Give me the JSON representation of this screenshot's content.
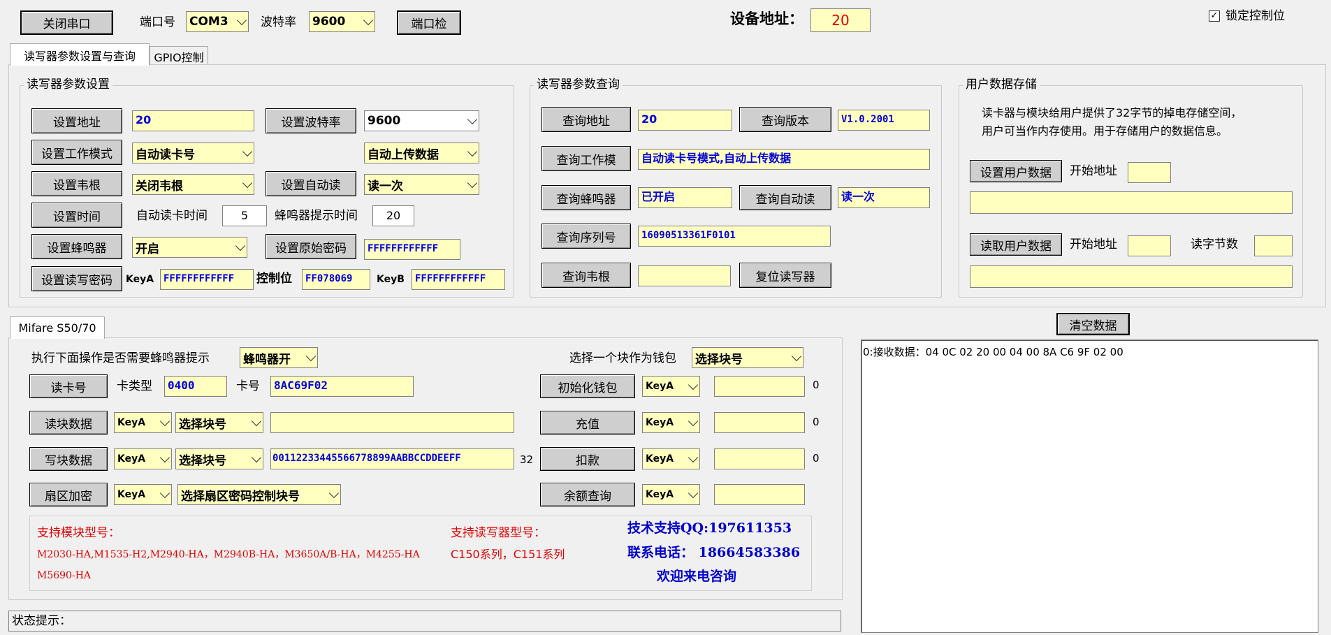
{
  "top": {
    "close_port": "关闭串口",
    "port_label": "端口号",
    "port_value": "COM3",
    "baud_label": "波特率",
    "baud_value": "9600",
    "port_check": "端口检",
    "device_addr_label": "设备地址：",
    "device_addr_value": "20",
    "lock_label": "锁定控制位",
    "lock_checked": true
  },
  "tabs": [
    "读写器参数设置与查询",
    "GPIO控制"
  ],
  "settings": {
    "title": "读写器参数设置",
    "set_addr": "设置地址",
    "addr_value": "20",
    "set_baud": "设置波特率",
    "baud_value": "9600",
    "set_mode": "设置工作模式",
    "mode_value": "自动读卡号",
    "upload_value": "自动上传数据",
    "set_wiegand": "设置韦根",
    "wiegand_value": "关闭韦根",
    "set_autoread": "设置自动读",
    "autoread_value": "读一次",
    "set_time": "设置时间",
    "autoread_time_label": "自动读卡时间",
    "autoread_time": "5",
    "buzzer_time_label": "蜂鸣器提示时间",
    "buzzer_time": "20",
    "set_buzzer": "设置蜂鸣器",
    "buzzer_value": "开启",
    "set_orig_pwd": "设置原始密码",
    "orig_pwd": "FFFFFFFFFFFF",
    "set_rw_pwd": "设置读写密码",
    "keya_label": "KeyA",
    "keya": "FFFFFFFFFFFF",
    "ctrl_label": "控制位",
    "ctrl": "FF078069",
    "keyb_label": "KeyB",
    "keyb": "FFFFFFFFFFFF"
  },
  "query": {
    "title": "读写器参数查询",
    "q_addr": "查询地址",
    "addr": "20",
    "q_version": "查询版本",
    "version": "V1.0.2001",
    "q_mode": "查询工作模",
    "mode": "自动读卡号模式,自动上传数据",
    "q_buzzer": "查询蜂鸣器",
    "buzzer": "已开启",
    "q_autoread": "查询自动读",
    "autoread": "读一次",
    "q_serial": "查询序列号",
    "serial": "16090513361F0101",
    "q_wiegand": "查询韦根",
    "wiegand": "",
    "reset": "复位读写器"
  },
  "userdata": {
    "title": "用户数据存储",
    "desc1": "读卡器与模块给用户提供了32字节的掉电存储空间，",
    "desc2": "用户可当作内存使用。用于存储用户的数据信息。",
    "set_btn": "设置用户数据",
    "start_label": "开始地址",
    "start_value": "",
    "set_data": "",
    "read_btn": "读取用户数据",
    "read_start_label": "开始地址",
    "read_start": "",
    "read_len_label": "读字节数",
    "read_len": "",
    "read_data": ""
  },
  "mifare": {
    "tab": "Mifare S50/70",
    "buzzer_prompt": "执行下面操作是否需要蜂鸣器提示",
    "buzzer_value": "蜂鸣器开",
    "wallet_label": "选择一个块作为钱包",
    "wallet_value": "选择块号",
    "read_card": "读卡号",
    "card_type_label": "卡类型",
    "card_type": "0400",
    "card_no_label": "卡号",
    "card_no": "8AC69F02",
    "read_block": "读块数据",
    "rb_key": "KeyA",
    "rb_block": "选择块号",
    "rb_data": "",
    "write_block": "写块数据",
    "wb_key": "KeyA",
    "wb_block": "选择块号",
    "wb_data": "00112233445566778899AABBCCDDEEFF",
    "wb_len": "32",
    "encrypt": "扇区加密",
    "enc_key": "KeyA",
    "enc_block": "选择扇区密码控制块号",
    "init_wallet": "初始化钱包",
    "iw_key": "KeyA",
    "iw_value": "",
    "iw_count": "0",
    "recharge": "充值",
    "rc_key": "KeyA",
    "rc_value": "",
    "rc_count": "0",
    "deduct": "扣款",
    "dd_key": "KeyA",
    "dd_value": "",
    "dd_count": "0",
    "balance": "余额查询",
    "bl_key": "KeyA",
    "bl_value": ""
  },
  "info": {
    "module_title": "支持模块型号：",
    "module_list1": "M2030-HA,M1535-H2,M2940-HA，M2940B-HA，M3650A/B-HA，M4255-HA",
    "module_list2": "M5690-HA",
    "reader_title": "支持读写器型号：",
    "reader_list": "C150系列，C151系列",
    "qq": "技术支持QQ:197611353",
    "phone": "联系电话： 18664583386",
    "welcome": "欢迎来电咨询"
  },
  "log": {
    "clear": "清空数据",
    "line": "0:接收数据：04 0C 02 20 00 04 00 8A C6 9F 02 00"
  },
  "status_label": "状态提示："
}
